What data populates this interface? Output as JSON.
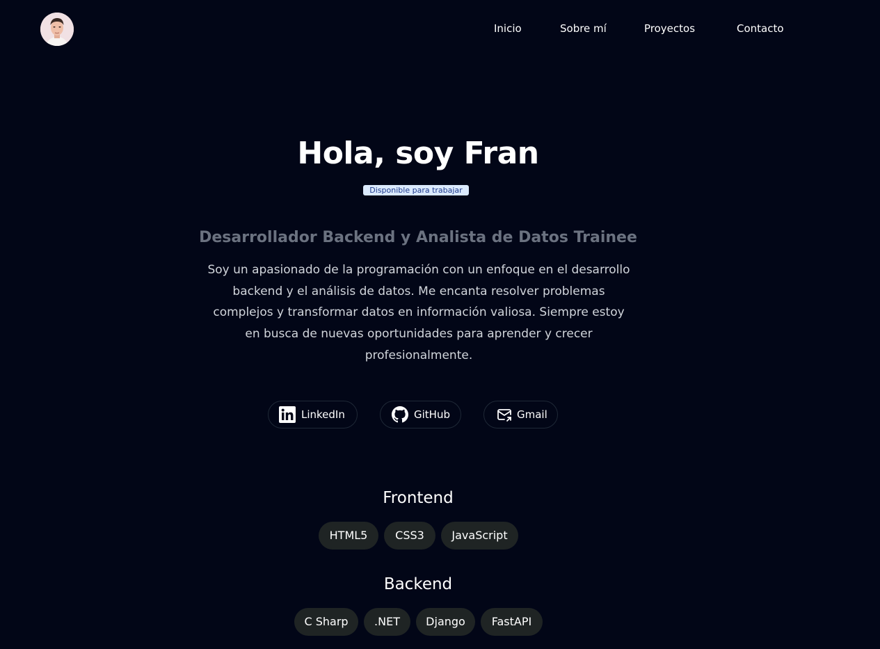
{
  "header": {
    "avatar_alt": "Fran",
    "nav": [
      {
        "label": "Inicio"
      },
      {
        "label": "Sobre mí"
      },
      {
        "label": "Proyectos"
      },
      {
        "label": "Contacto"
      }
    ]
  },
  "hero": {
    "title": "Hola, soy Fran",
    "badge": "Disponible para trabajar",
    "subtitle": "Desarrollador Backend y Analista de Datos Trainee",
    "bio": "Soy un apasionado de la programación con un enfoque en el desarrollo backend y el análisis de datos. Me encanta resolver problemas complejos y transformar datos en información valiosa. Siempre estoy en busca de nuevas oportunidades para aprender y crecer profesionalmente."
  },
  "social": [
    {
      "label": "LinkedIn",
      "icon": "linkedin-icon"
    },
    {
      "label": "GitHub",
      "icon": "github-icon"
    },
    {
      "label": "Gmail",
      "icon": "mail-icon"
    }
  ],
  "skills": {
    "frontend": {
      "title": "Frontend",
      "items": [
        "HTML5",
        "CSS3",
        "JavaScript"
      ]
    },
    "backend": {
      "title": "Backend",
      "items": [
        "C Sharp",
        ".NET",
        "Django",
        "FastAPI"
      ]
    }
  },
  "colors": {
    "background": "#020617",
    "badge_bg": "#dbeafe",
    "badge_text": "#1e3a8a",
    "subtitle": "#6b7280",
    "bio_text": "#d1d5db",
    "pill_bg": "#1f2424"
  }
}
